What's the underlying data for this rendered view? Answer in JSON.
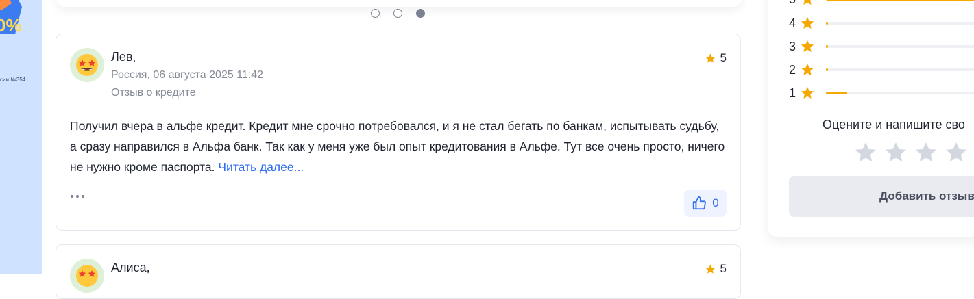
{
  "promo": {
    "percent_text": "0%",
    "fine_print": "сии №354."
  },
  "slider": {
    "dots": 3,
    "active_index": 2
  },
  "reviews": [
    {
      "author": "Лев,",
      "location_date": "Россия, 06 августа 2025 11:42",
      "type": "Отзыв о кредите",
      "rating": "5",
      "text": "Получил вчера в альфе кредит. Кредит мне срочно потребовался, и я не стал бегать по банкам, испытывать судьбу, а сразу направился в Альфа банк. Так как у меня уже был опыт кредитования в Альфе. Тут все очень просто, ничего не нужно кроме паспорта.",
      "read_more": "Читать далее...",
      "likes": "0",
      "avatar_icon": "star-struck-emoji-icon"
    },
    {
      "author": "Алиса,",
      "rating": "5",
      "avatar_icon": "star-struck-emoji-icon"
    }
  ],
  "sidebar": {
    "distribution": [
      {
        "label": "5",
        "fraction": 1.0
      },
      {
        "label": "4",
        "fraction": 0.01
      },
      {
        "label": "3",
        "fraction": 0.005
      },
      {
        "label": "2",
        "fraction": 0.005
      },
      {
        "label": "1",
        "fraction": 0.11
      }
    ],
    "invite_text": "Оцените и напишите сво",
    "add_button": "Добавить отзыв"
  },
  "colors": {
    "accent": "#2f6df0",
    "star": "#f5a800",
    "star_empty": "#d3d7df"
  }
}
